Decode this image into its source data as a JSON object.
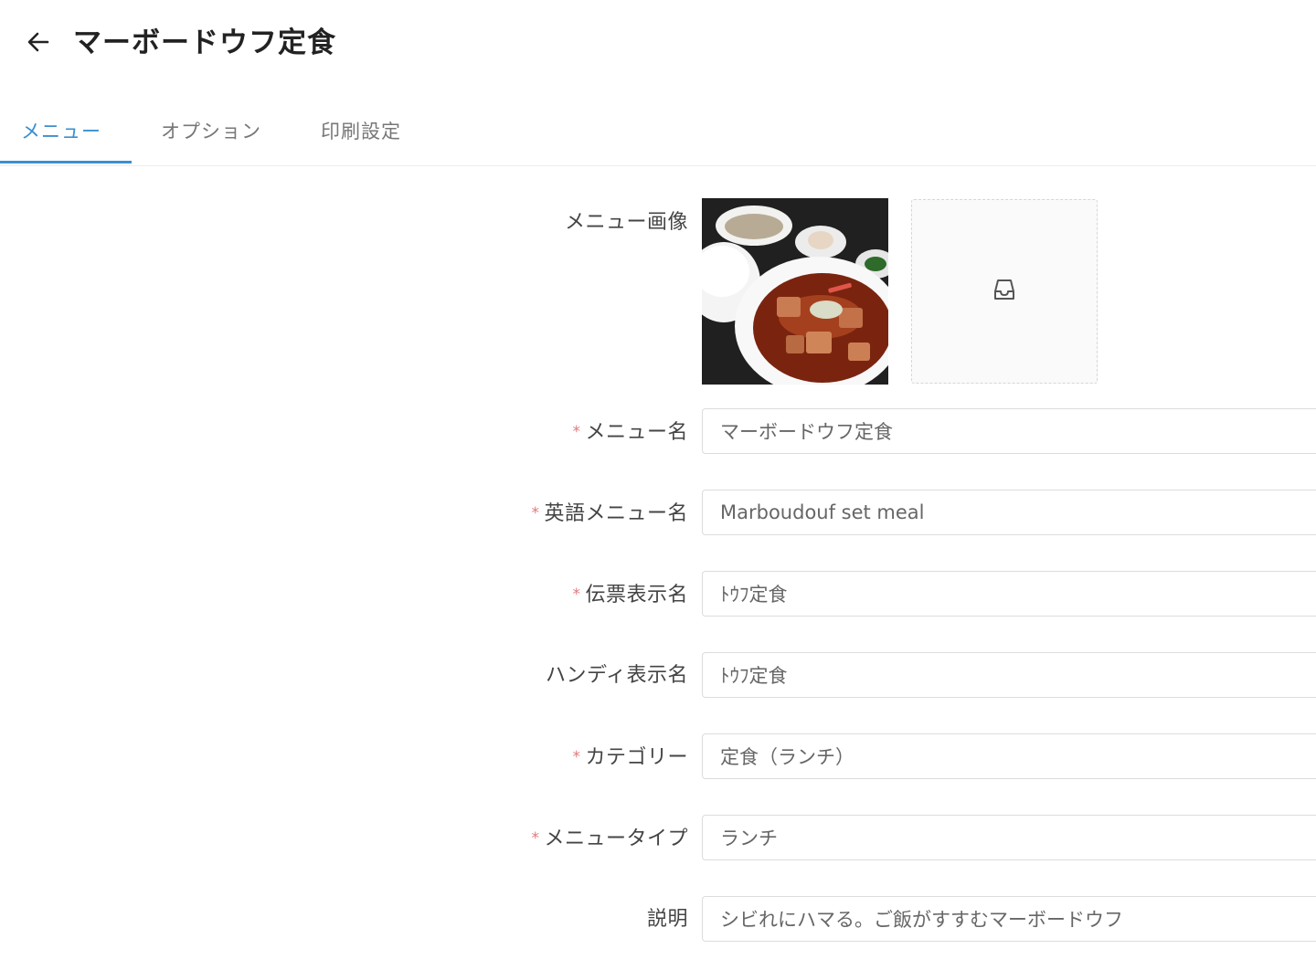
{
  "header": {
    "title": "マーボードウフ定食",
    "back_icon": "arrow-left-icon"
  },
  "tabs": [
    {
      "label": "メニュー",
      "active": true
    },
    {
      "label": "オプション",
      "active": false
    },
    {
      "label": "印刷設定",
      "active": false
    }
  ],
  "colors": {
    "accent": "#3c8fcf",
    "required": "#e07a7a",
    "border": "#dcdcdc"
  },
  "form": {
    "image_label": "メニュー画像",
    "upload_icon": "inbox-icon",
    "required_mark": "*",
    "fields": [
      {
        "label": "メニュー名",
        "required": true,
        "value": "マーボードウフ定食"
      },
      {
        "label": "英語メニュー名",
        "required": true,
        "value": "Marboudouf set meal"
      },
      {
        "label": "伝票表示名",
        "required": true,
        "value": "ﾄｳﾌ定食"
      },
      {
        "label": "ハンディ表示名",
        "required": false,
        "value": "ﾄｳﾌ定食"
      },
      {
        "label": "カテゴリー",
        "required": true,
        "value": "定食（ランチ）"
      },
      {
        "label": "メニュータイプ",
        "required": true,
        "value": "ランチ"
      },
      {
        "label": "説明",
        "required": false,
        "value": "シビれにハマる。ご飯がすすむマーボードウフ"
      }
    ]
  }
}
